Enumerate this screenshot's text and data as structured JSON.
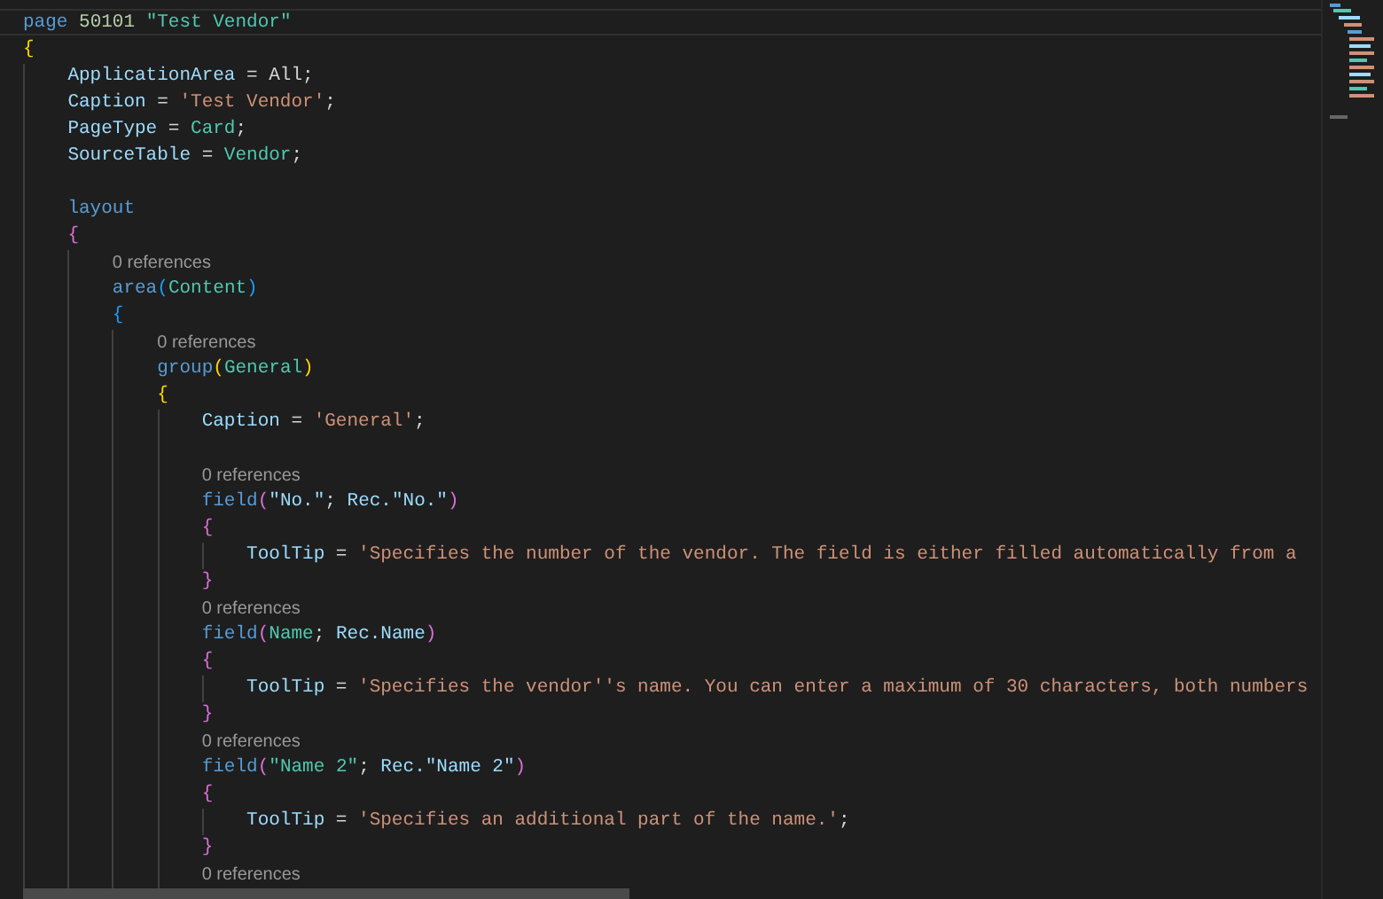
{
  "editor": {
    "lines": [
      {
        "kind": "code",
        "current": true,
        "tokens": [
          {
            "kind": "kw",
            "text": "page "
          },
          {
            "kind": "num",
            "text": "50101 "
          },
          {
            "kind": "type",
            "text": "\"Test Vendor\""
          }
        ]
      },
      {
        "kind": "code",
        "current": false,
        "tokens": [
          {
            "kind": "b1",
            "text": "{"
          }
        ]
      },
      {
        "kind": "code",
        "current": false,
        "tokens": [
          {
            "kind": "prop",
            "text": "    ApplicationArea"
          },
          {
            "kind": "op",
            "text": " = All;"
          }
        ]
      },
      {
        "kind": "code",
        "current": false,
        "tokens": [
          {
            "kind": "prop",
            "text": "    Caption"
          },
          {
            "kind": "op",
            "text": " = "
          },
          {
            "kind": "str",
            "text": "'Test Vendor'"
          },
          {
            "kind": "op",
            "text": ";"
          }
        ]
      },
      {
        "kind": "code",
        "current": false,
        "tokens": [
          {
            "kind": "prop",
            "text": "    PageType"
          },
          {
            "kind": "op",
            "text": " = "
          },
          {
            "kind": "type",
            "text": "Card"
          },
          {
            "kind": "op",
            "text": ";"
          }
        ]
      },
      {
        "kind": "code",
        "current": false,
        "tokens": [
          {
            "kind": "prop",
            "text": "    SourceTable"
          },
          {
            "kind": "op",
            "text": " = "
          },
          {
            "kind": "type",
            "text": "Vendor"
          },
          {
            "kind": "op",
            "text": ";"
          }
        ]
      },
      {
        "kind": "blank",
        "current": false
      },
      {
        "kind": "code",
        "current": false,
        "tokens": [
          {
            "kind": "kw",
            "text": "    layout"
          }
        ]
      },
      {
        "kind": "code",
        "current": false,
        "tokens": [
          {
            "kind": "b2",
            "text": "    {"
          }
        ]
      },
      {
        "kind": "lens",
        "current": false,
        "text": "        0 references"
      },
      {
        "kind": "code",
        "current": false,
        "tokens": [
          {
            "kind": "kw",
            "text": "        area"
          },
          {
            "kind": "b3",
            "text": "("
          },
          {
            "kind": "type",
            "text": "Content"
          },
          {
            "kind": "b3",
            "text": ")"
          }
        ]
      },
      {
        "kind": "code",
        "current": false,
        "tokens": [
          {
            "kind": "b3",
            "text": "        {"
          }
        ]
      },
      {
        "kind": "lens",
        "current": false,
        "text": "            0 references"
      },
      {
        "kind": "code",
        "current": false,
        "tokens": [
          {
            "kind": "kw",
            "text": "            group"
          },
          {
            "kind": "b1",
            "text": "("
          },
          {
            "kind": "type",
            "text": "General"
          },
          {
            "kind": "b1",
            "text": ")"
          }
        ]
      },
      {
        "kind": "code",
        "current": false,
        "tokens": [
          {
            "kind": "b1",
            "text": "            {"
          }
        ]
      },
      {
        "kind": "code",
        "current": false,
        "tokens": [
          {
            "kind": "prop",
            "text": "                Caption"
          },
          {
            "kind": "op",
            "text": " = "
          },
          {
            "kind": "str",
            "text": "'General'"
          },
          {
            "kind": "op",
            "text": ";"
          }
        ]
      },
      {
        "kind": "blank",
        "current": false
      },
      {
        "kind": "lens",
        "current": false,
        "text": "                0 references"
      },
      {
        "kind": "code",
        "current": false,
        "tokens": [
          {
            "kind": "kw",
            "text": "                field"
          },
          {
            "kind": "b2",
            "text": "("
          },
          {
            "kind": "prop",
            "text": "\"No.\""
          },
          {
            "kind": "op",
            "text": "; "
          },
          {
            "kind": "prop",
            "text": "Rec.\"No.\""
          },
          {
            "kind": "b2",
            "text": ")"
          }
        ]
      },
      {
        "kind": "code",
        "current": false,
        "tokens": [
          {
            "kind": "b2",
            "text": "                {"
          }
        ]
      },
      {
        "kind": "code",
        "current": false,
        "tokens": [
          {
            "kind": "prop",
            "text": "                    ToolTip"
          },
          {
            "kind": "op",
            "text": " = "
          },
          {
            "kind": "str",
            "text": "'Specifies the number of the vendor. The field is either filled automatically from a"
          }
        ]
      },
      {
        "kind": "code",
        "current": false,
        "tokens": [
          {
            "kind": "b2",
            "text": "                }"
          }
        ]
      },
      {
        "kind": "lens",
        "current": false,
        "text": "                0 references"
      },
      {
        "kind": "code",
        "current": false,
        "tokens": [
          {
            "kind": "kw",
            "text": "                field"
          },
          {
            "kind": "b2",
            "text": "("
          },
          {
            "kind": "type",
            "text": "Name"
          },
          {
            "kind": "op",
            "text": "; "
          },
          {
            "kind": "prop",
            "text": "Rec.Name"
          },
          {
            "kind": "b2",
            "text": ")"
          }
        ]
      },
      {
        "kind": "code",
        "current": false,
        "tokens": [
          {
            "kind": "b2",
            "text": "                {"
          }
        ]
      },
      {
        "kind": "code",
        "current": false,
        "tokens": [
          {
            "kind": "prop",
            "text": "                    ToolTip"
          },
          {
            "kind": "op",
            "text": " = "
          },
          {
            "kind": "str",
            "text": "'Specifies the vendor''s name. You can enter a maximum of 30 characters, both numbers"
          }
        ]
      },
      {
        "kind": "code",
        "current": false,
        "tokens": [
          {
            "kind": "b2",
            "text": "                }"
          }
        ]
      },
      {
        "kind": "lens",
        "current": false,
        "text": "                0 references"
      },
      {
        "kind": "code",
        "current": false,
        "tokens": [
          {
            "kind": "kw",
            "text": "                field"
          },
          {
            "kind": "b2",
            "text": "("
          },
          {
            "kind": "type",
            "text": "\"Name 2\""
          },
          {
            "kind": "op",
            "text": "; "
          },
          {
            "kind": "prop",
            "text": "Rec.\"Name 2\""
          },
          {
            "kind": "b2",
            "text": ")"
          }
        ]
      },
      {
        "kind": "code",
        "current": false,
        "tokens": [
          {
            "kind": "b2",
            "text": "                {"
          }
        ]
      },
      {
        "kind": "code",
        "current": false,
        "tokens": [
          {
            "kind": "prop",
            "text": "                    ToolTip"
          },
          {
            "kind": "op",
            "text": " = "
          },
          {
            "kind": "str",
            "text": "'Specifies an additional part of the name.'"
          },
          {
            "kind": "op",
            "text": ";"
          }
        ]
      },
      {
        "kind": "code",
        "current": false,
        "tokens": [
          {
            "kind": "b2",
            "text": "                }"
          }
        ]
      },
      {
        "kind": "lens",
        "current": false,
        "text": "                0 references"
      }
    ]
  }
}
